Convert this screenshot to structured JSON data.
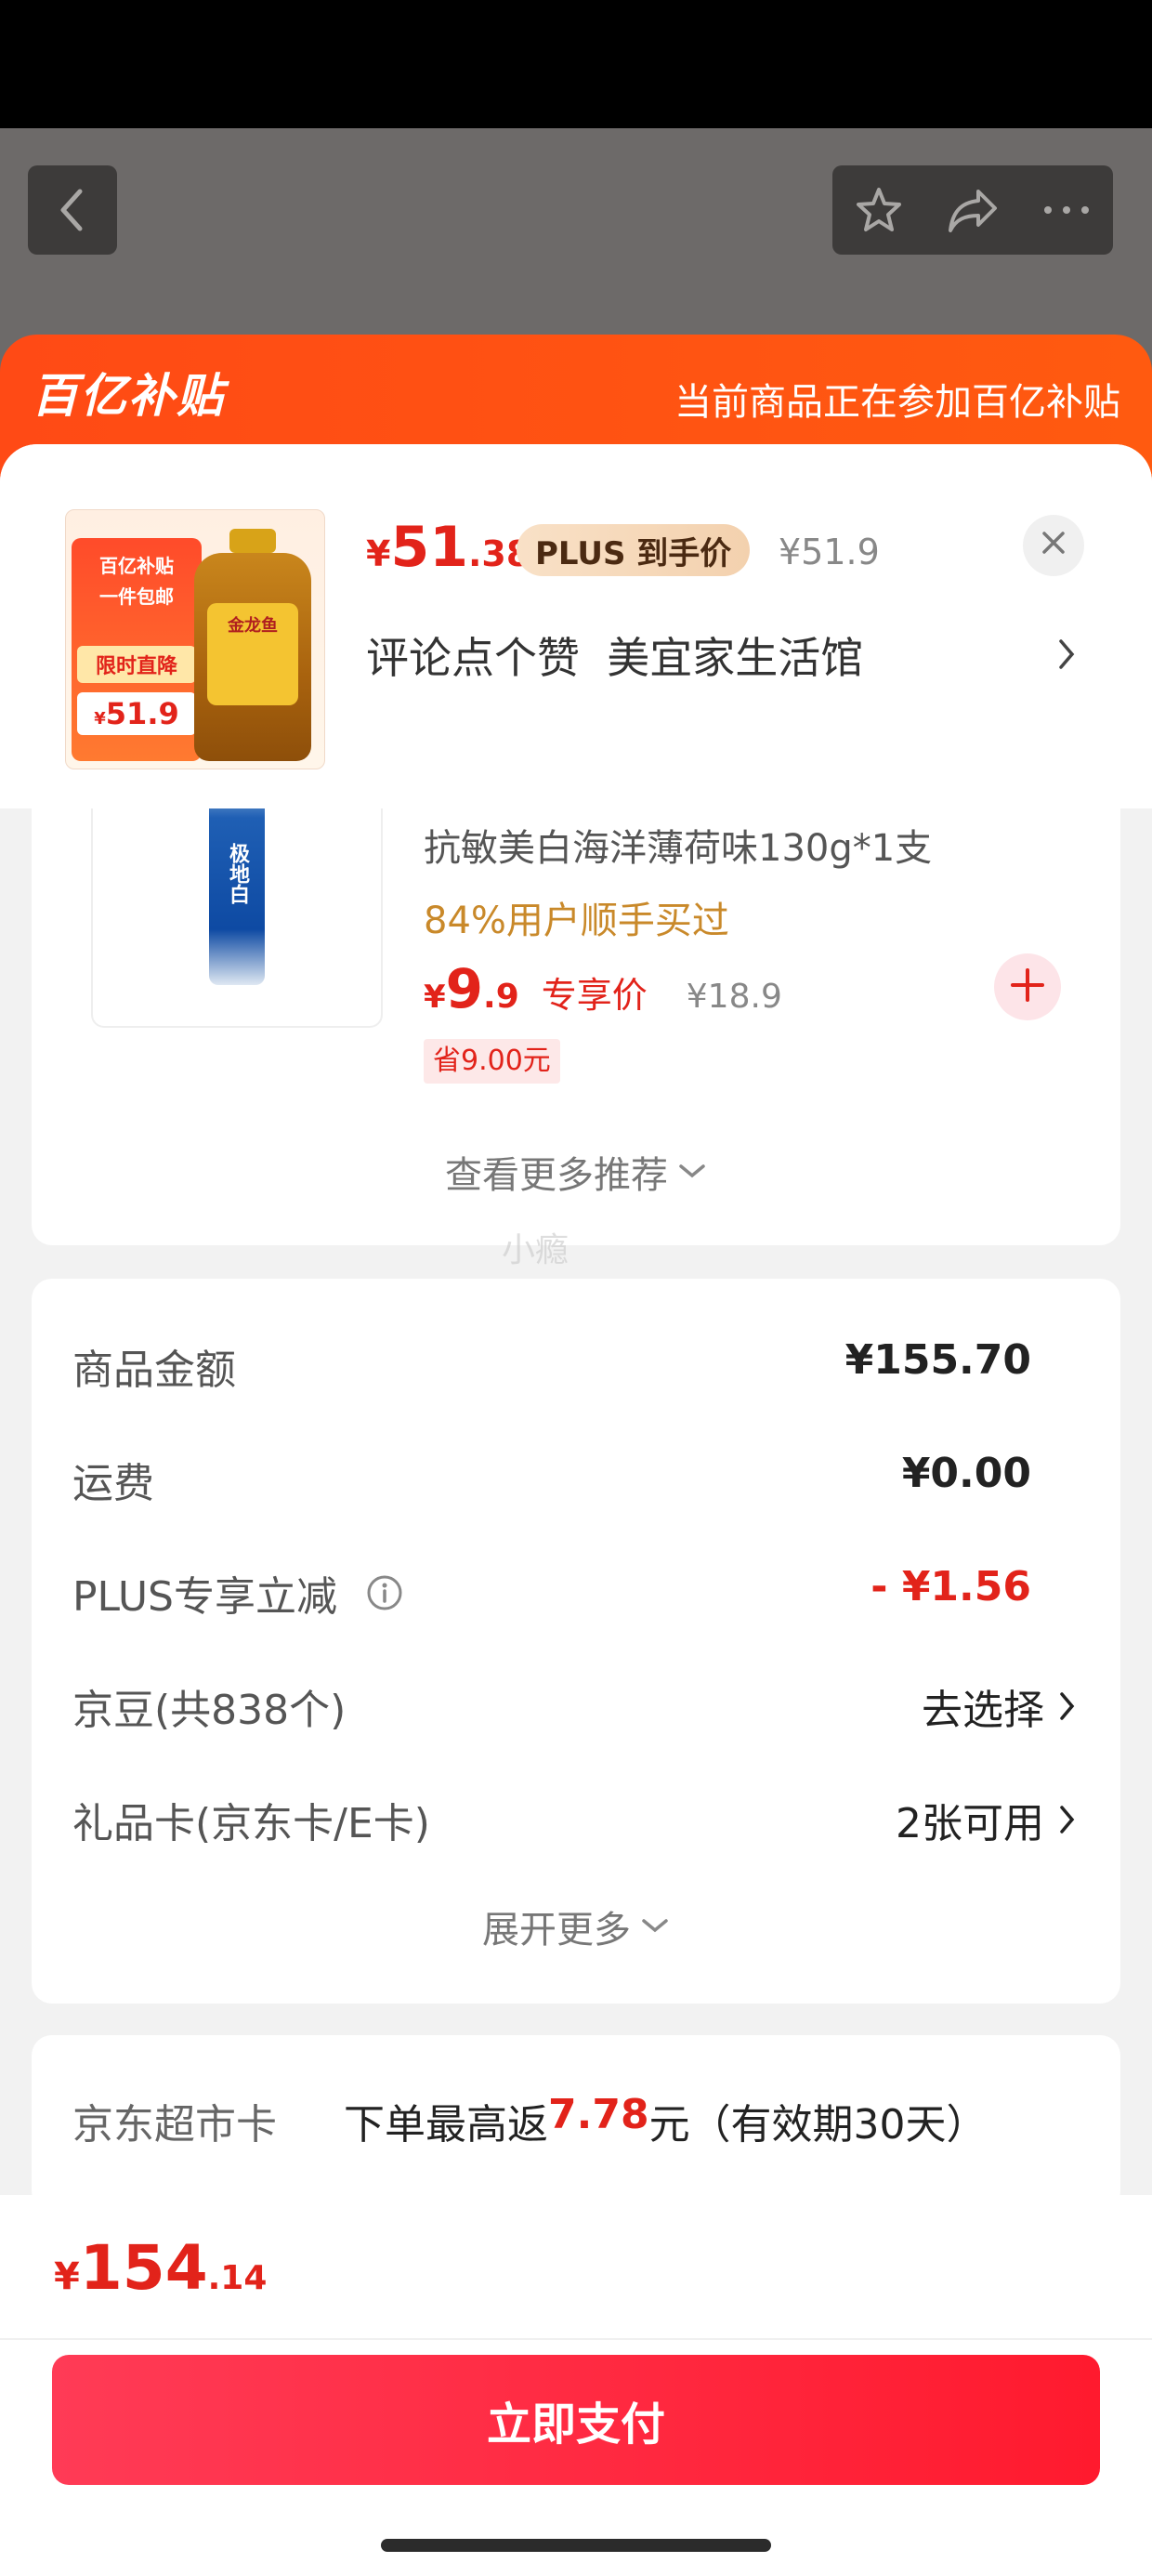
{
  "banner": {
    "logo": "百亿补贴",
    "note": "当前商品正在参加百亿补贴"
  },
  "product": {
    "price_symbol": "¥",
    "price_int": "51",
    "price_dec": ".38",
    "plus_tag": "PLUS 到手价",
    "original_price": "¥51.9",
    "title": "评论点个赞  美宜家生活馆",
    "thumb_badge_line1": "百亿补贴",
    "thumb_badge_line2": "一件包邮",
    "thumb_badge_line3": "限时直降",
    "thumb_price": "51.9",
    "thumb_price_symbol": "¥",
    "thumb_brand": "金龙鱼"
  },
  "recommend": {
    "item_name": "抗敏美白海洋薄荷味130g*1支",
    "item_social": "84%用户顺手买过",
    "item_price_symbol": "¥",
    "item_price_int": "9",
    "item_price_dec": ".9",
    "item_price_tag": "专享价",
    "item_original_price": "¥18.9",
    "item_saving": "省9.00元",
    "tube_label": "极地白",
    "more_label": "查看更多推荐",
    "watermark": "小瘾"
  },
  "summary": {
    "rows": [
      {
        "label": "商品金额",
        "value": "¥155.70"
      },
      {
        "label": "运费",
        "value": "¥0.00"
      },
      {
        "label": "PLUS专享立减",
        "value": "- ¥1.56"
      },
      {
        "label": "京豆(共838个)",
        "value": "去选择"
      },
      {
        "label": "礼品卡(京东卡/E卡)",
        "value": "2张可用"
      }
    ],
    "expand_label": "展开更多"
  },
  "supermarket": {
    "label": "京东超市卡",
    "text_prefix": "下单最高返",
    "amount": "7.78",
    "text_suffix": "元（有效期30天）"
  },
  "footer": {
    "total_symbol": "¥",
    "total_int": "154",
    "total_dec": ".14",
    "pay_label": "立即支付"
  },
  "colors": {
    "accent": "#e2231a",
    "banner": "#ff4a15",
    "pay": "#ff2b40",
    "gold": "#c9892a"
  }
}
